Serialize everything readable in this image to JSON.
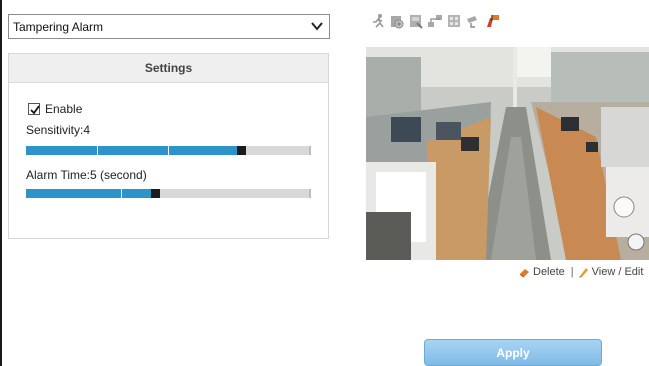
{
  "alarm_type": {
    "selected": "Tampering Alarm"
  },
  "settings": {
    "title": "Settings",
    "enable_label": "Enable",
    "enable_checked": true,
    "sensitivity_label": "Sensitivity:4",
    "sensitivity_level_fraction": 0.74,
    "alarm_time_label": "Alarm Time:5 (second)",
    "alarm_time_level_fraction": 0.44
  },
  "toolbar": {
    "icons": [
      "motion-person-icon",
      "audio-detect-icon",
      "tampering-icon",
      "network-icon",
      "intrusion-icon",
      "camera-icon",
      "alarm-out-icon"
    ]
  },
  "camera": {
    "feed": "office-fisheye-view"
  },
  "actions": {
    "delete_label": "Delete",
    "separator": "|",
    "view_edit_label": "View / Edit"
  },
  "apply_label": "Apply",
  "colors": {
    "slider_fill": "#2e93c8",
    "slider_track": "#d9d9d9",
    "apply_button": "#8fc5eb",
    "accent_orange": "#e07a2a"
  }
}
